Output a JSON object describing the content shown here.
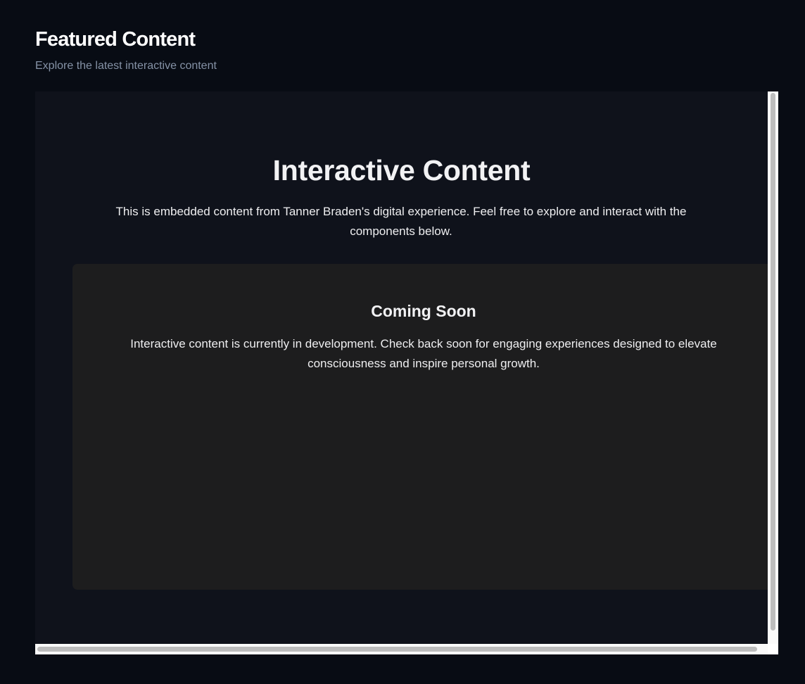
{
  "section": {
    "title": "Featured Content",
    "subtitle": "Explore the latest interactive content"
  },
  "embed": {
    "title": "Interactive Content",
    "description": "This is embedded content from Tanner Braden's digital experience. Feel free to explore and interact with the components below.",
    "card": {
      "title": "Coming Soon",
      "text": "Interactive content is currently in development. Check back soon for engaging experiences designed to elevate consciousness and inspire personal growth."
    }
  },
  "colors": {
    "page_background": "#080c14",
    "embed_background": "#0f121b",
    "card_background": "#1d1d1e",
    "subtitle_text": "#8592a6",
    "scrollbar_track": "#fafafa",
    "scrollbar_thumb": "#bdbdbd"
  }
}
